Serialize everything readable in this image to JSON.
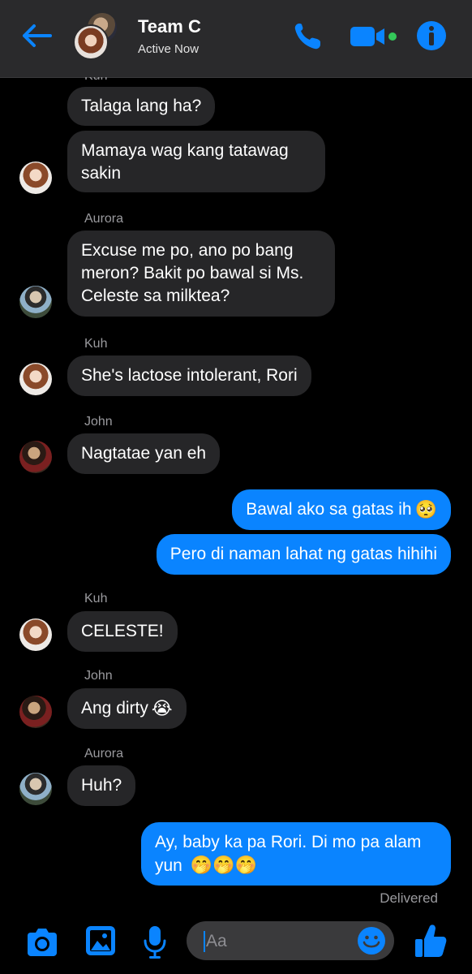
{
  "header": {
    "title": "Team C",
    "status": "Active Now"
  },
  "messages": [
    {
      "sender": "Kuh",
      "direction": "in",
      "text": "Talaga lang ha?"
    },
    {
      "sender": "Kuh",
      "direction": "in",
      "text": "Mamaya wag kang tatawag sakin"
    },
    {
      "sender": "Aurora",
      "direction": "in",
      "text": "Excuse me po, ano po bang meron? Bakit po bawal si Ms. Celeste sa milktea?"
    },
    {
      "sender": "Kuh",
      "direction": "in",
      "text": "She's lactose intolerant, Rori"
    },
    {
      "sender": "John",
      "direction": "in",
      "text": "Nagtatae yan eh"
    },
    {
      "sender": "",
      "direction": "out",
      "text": "Bawal ako sa gatas ih",
      "emoji": "🥺"
    },
    {
      "sender": "",
      "direction": "out",
      "text": "Pero di naman lahat ng gatas hihihi"
    },
    {
      "sender": "Kuh",
      "direction": "in",
      "text": "CELESTE!"
    },
    {
      "sender": "John",
      "direction": "in",
      "text": "Ang dirty",
      "emoji": "😭"
    },
    {
      "sender": "Aurora",
      "direction": "in",
      "text": "Huh?"
    },
    {
      "sender": "",
      "direction": "out",
      "text": "Ay, baby ka pa Rori. Di mo pa alam yun",
      "emoji": "🤭🤭🤭"
    }
  ],
  "labels": {
    "kuh": "Kuh",
    "aurora": "Aurora",
    "john": "John",
    "kuh_top": "Kuh"
  },
  "receipt": "Delivered",
  "composer": {
    "placeholder": "Aa"
  },
  "icons": {
    "back": "back-arrow-icon",
    "call": "phone-icon",
    "video": "video-camera-icon",
    "info": "info-icon",
    "camera": "camera-icon",
    "gallery": "image-gallery-icon",
    "microphone": "microphone-icon",
    "emoji": "smiley-icon",
    "like": "thumbs-up-icon"
  },
  "colors": {
    "accent": "#0a84ff",
    "header_bg": "#2a2a2c",
    "incoming_bubble": "#262628",
    "outgoing_bubble": "#0a84ff",
    "background": "#000000",
    "video_active_dot": "#34c759"
  }
}
